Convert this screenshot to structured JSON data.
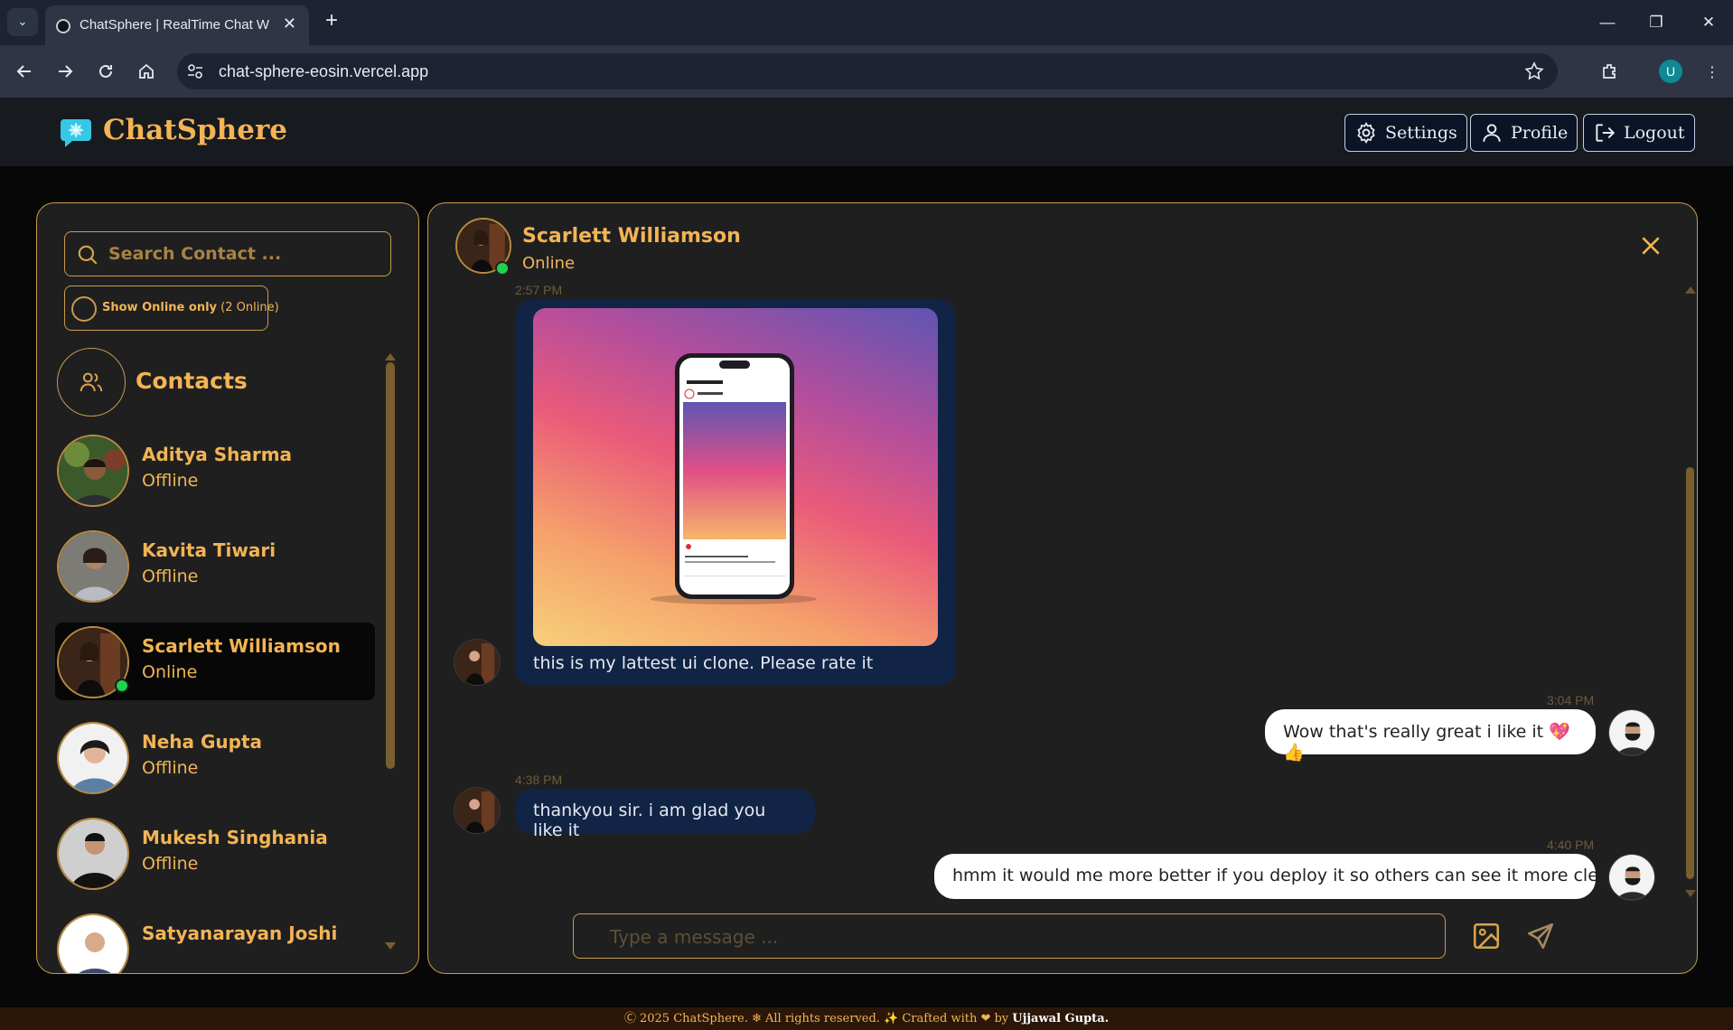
{
  "browser": {
    "tab_title": "ChatSphere | RealTime Chat With",
    "url": "chat-sphere-eosin.vercel.app",
    "profile_initial": "U"
  },
  "header": {
    "brand": "ChatSphere",
    "settings_label": "Settings",
    "profile_label": "Profile",
    "logout_label": "Logout"
  },
  "sidebar": {
    "search_placeholder": "Search Contact ...",
    "online_toggle": {
      "label": "Show Online only",
      "count": "(2 Online)"
    },
    "contacts_title": "Contacts",
    "contacts": [
      {
        "name": "Aditya Sharma",
        "status": "Offline"
      },
      {
        "name": "Kavita Tiwari",
        "status": "Offline"
      },
      {
        "name": "Scarlett Williamson",
        "status": "Online"
      },
      {
        "name": "Neha Gupta",
        "status": "Offline"
      },
      {
        "name": "Mukesh Singhania",
        "status": "Offline"
      },
      {
        "name": "Satyanarayan Joshi",
        "status": ""
      }
    ]
  },
  "chat": {
    "name": "Scarlett Williamson",
    "status": "Online",
    "messages": [
      {
        "direction": "in",
        "time": "2:57 PM",
        "text": "this is my lattest ui clone. Please rate it",
        "has_image": true
      },
      {
        "direction": "out",
        "time": "3:04 PM",
        "text": "Wow that's really great i like it 💖 👍"
      },
      {
        "direction": "in",
        "time": "4:38 PM",
        "text": "thankyou sir. i am glad you like it"
      },
      {
        "direction": "out",
        "time": "4:40 PM",
        "text": "hmm it would me more better if you deploy it so others can see it more clearly"
      }
    ],
    "composer_placeholder": "Type a message ..."
  },
  "footer": {
    "text_before": "Ⓒ 2025 ChatSphere. ❄ All rights reserved. ✨ Crafted with ❤ by ",
    "author": "Ujjawal Gupta."
  },
  "colors": {
    "accent": "#f2b454",
    "border": "#c89b4a",
    "online": "#1fd24c",
    "incoming_bubble": "#112446"
  }
}
